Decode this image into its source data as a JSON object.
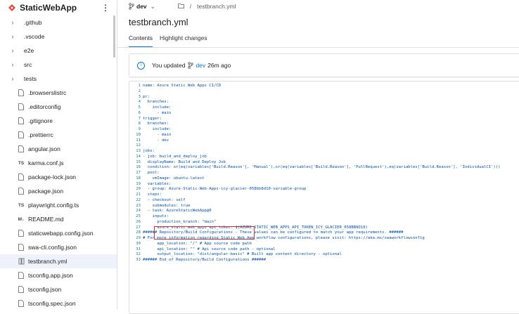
{
  "repo": {
    "name": "StaticWebApp"
  },
  "tree": [
    {
      "kind": "folder",
      "label": ".github",
      "icon": "folder"
    },
    {
      "kind": "folder",
      "label": ".vscode",
      "icon": "folder"
    },
    {
      "kind": "folder",
      "label": "e2e",
      "icon": "folder"
    },
    {
      "kind": "folder",
      "label": "src",
      "icon": "folder"
    },
    {
      "kind": "folder",
      "label": "tests",
      "icon": "folder"
    },
    {
      "kind": "file",
      "label": ".browserslistrc",
      "icon": "file"
    },
    {
      "kind": "file",
      "label": ".editorconfig",
      "icon": "file"
    },
    {
      "kind": "file",
      "label": ".gitignore",
      "icon": "file"
    },
    {
      "kind": "file",
      "label": ".prettierrc",
      "icon": "file"
    },
    {
      "kind": "file",
      "label": "angular.json",
      "icon": "file"
    },
    {
      "kind": "file",
      "label": "karma.conf.js",
      "icon": "ts"
    },
    {
      "kind": "file",
      "label": "package-lock.json",
      "icon": "file"
    },
    {
      "kind": "file",
      "label": "package.json",
      "icon": "file"
    },
    {
      "kind": "file",
      "label": "playwright.config.ts",
      "icon": "ts"
    },
    {
      "kind": "file",
      "label": "README.md",
      "icon": "md"
    },
    {
      "kind": "file",
      "label": "staticwebapp.config.json",
      "icon": "file"
    },
    {
      "kind": "file",
      "label": "swa-cli.config.json",
      "icon": "file"
    },
    {
      "kind": "file",
      "label": "testbranch.yml",
      "icon": "yml",
      "selected": true
    },
    {
      "kind": "file",
      "label": "tsconfig.app.json",
      "icon": "file"
    },
    {
      "kind": "file",
      "label": "tsconfig.json",
      "icon": "file"
    },
    {
      "kind": "file",
      "label": "tsconfig.spec.json",
      "icon": "file"
    }
  ],
  "breadcrumb": {
    "branch": "dev",
    "separator": "/",
    "file": "testbranch.yml"
  },
  "title": "testbranch.yml",
  "tabs": [
    "Contents",
    "Highlight changes"
  ],
  "banner": {
    "prefix": "You updated",
    "branch": "dev",
    "suffix": "26m ago"
  },
  "code": [
    "name: Azure Static Web Apps CI/CD",
    "",
    "pr:",
    "  branches:",
    "    include:",
    "      - main",
    "trigger:",
    "  branches:",
    "    include:",
    "      - main",
    "      - dev",
    "",
    "jobs:",
    "- job: build_and_deploy_job",
    "  displayName: Build and Deploy Job",
    "  condition: or(eq(variables['Build.Reason'], 'Manual'),or(eq(variables['Build.Reason'], 'PullRequest'),eq(variables['Build.Reason'], 'IndividualCI')))",
    "  pool:",
    "    vmImage: ubuntu-latest",
    "  variables:",
    "  - group: Azure-Static-Web-Apps-icy-glacier-058bb8d10-variable-group",
    "  steps:",
    "  - checkout: self",
    "    submodules: true",
    "  - task: AzureStaticWebApp@0",
    "    inputs:",
    "      production_branch: \"main\"",
    "      azure_static_web_apps_api_token: $(AZURE_STATIC_WEB_APPS_API_TOKEN_ICY_GLACIER_058BB8D10)",
    "###### Repository/Build Configurations - These values can be configured to match your app requirements. ######",
    "# For more information regarding Static Web App workflow configurations, please visit: https://aka.ms/swaworkflowconfig",
    "      app_location: \"/\" # App source code path",
    "      api_location: \"\" # Api source code path - optional",
    "      output_location: \"dist/angular-basic\" # Built app content directory - optional",
    "###### End of Repository/Build Configurations ######"
  ],
  "colors": {
    "accent": "#0078d4",
    "highlight_box": "#d13438",
    "selected_row": "#eef3fb"
  }
}
